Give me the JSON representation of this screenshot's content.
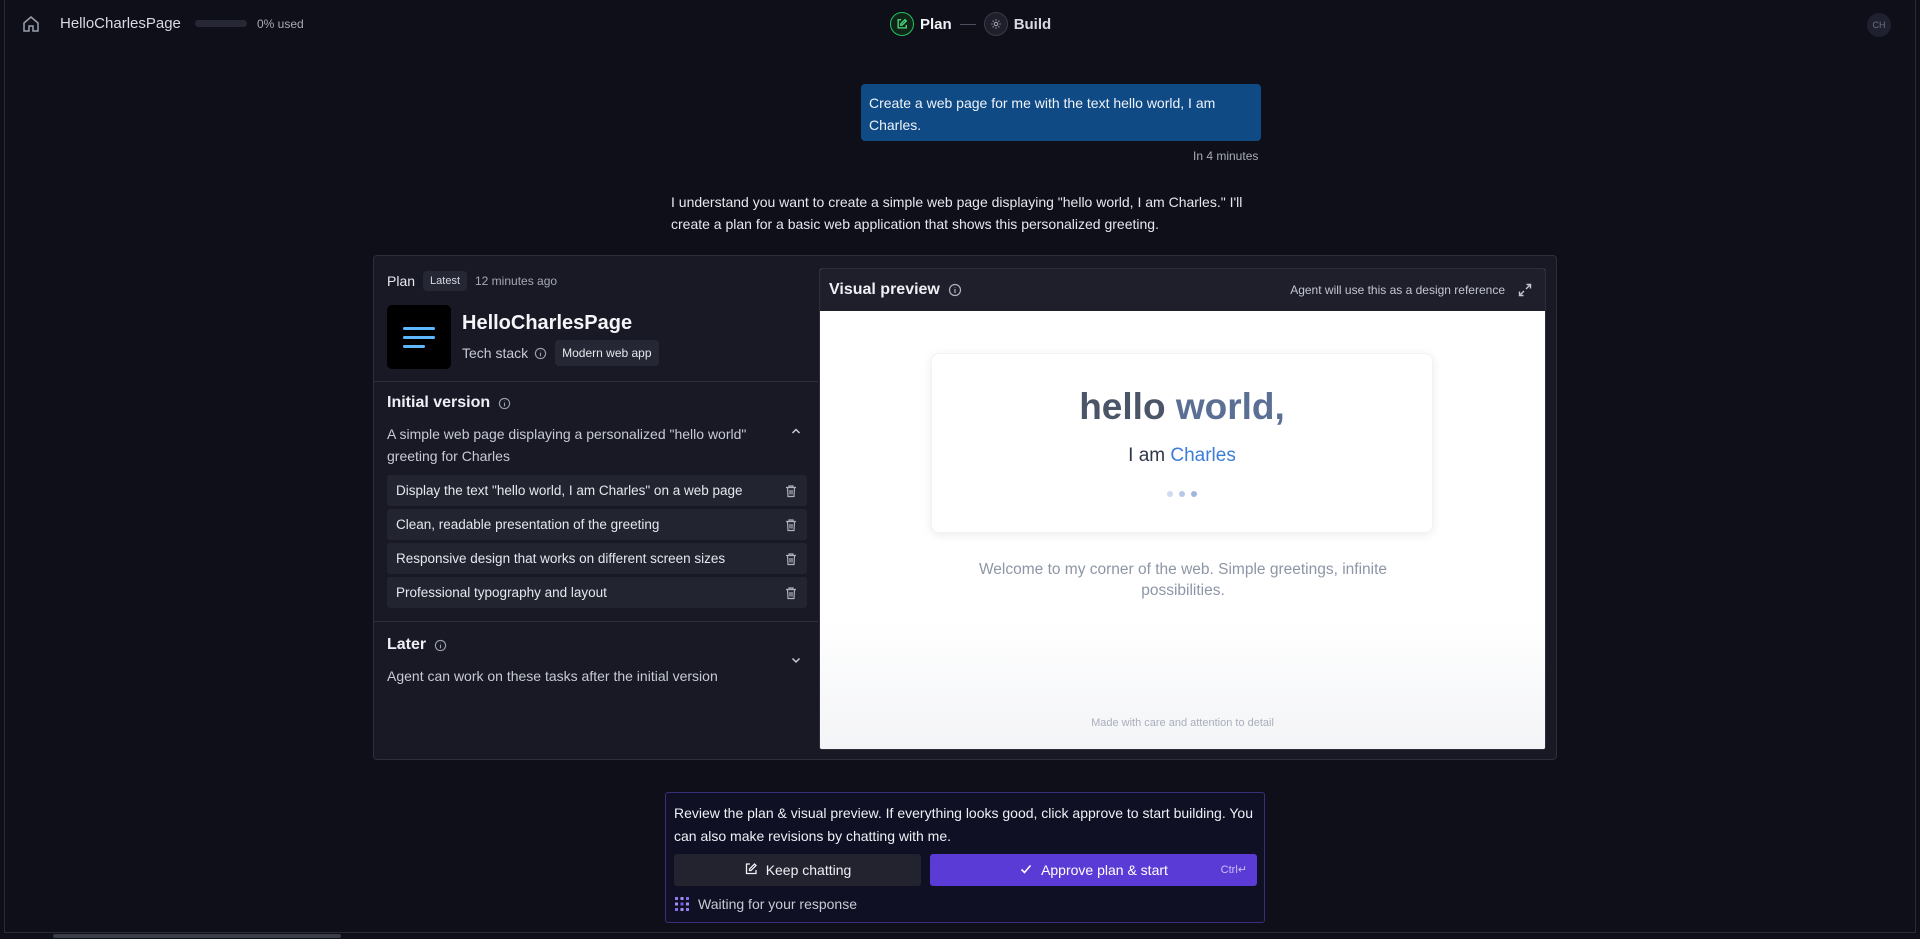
{
  "header": {
    "project_name": "HelloCharlesPage",
    "usage_text": "0% used",
    "usage_fraction": 0,
    "steps": [
      {
        "label": "Plan"
      },
      {
        "label": "Build"
      }
    ],
    "avatar_initials": "CH"
  },
  "chat": {
    "user_message": "Create a web page for me with the text hello world, I am Charles.",
    "user_time": "In 4 minutes",
    "assistant_message": "I understand you want to create a simple web page displaying \"hello world, I am Charles.\" I'll create a plan for a basic web application that shows this personalized greeting."
  },
  "plan": {
    "label": "Plan",
    "badge": "Latest",
    "time": "12 minutes ago",
    "app_title": "HelloCharlesPage",
    "tech_label": "Tech stack",
    "tech_chip": "Modern web app",
    "initial": {
      "title": "Initial version",
      "description": "A simple web page displaying a personalized \"hello world\" greeting for Charles",
      "tasks": [
        "Display the text \"hello world, I am Charles\" on a web page",
        "Clean, readable presentation of the greeting",
        "Responsive design that works on different screen sizes",
        "Professional typography and layout"
      ]
    },
    "later": {
      "title": "Later",
      "description": "Agent can work on these tasks after the initial version"
    }
  },
  "preview": {
    "title": "Visual preview",
    "note": "Agent will use this as a design reference",
    "hero_word1": "hello",
    "hero_word2": "world,",
    "sub_prefix": "I am",
    "sub_name": "Charles",
    "welcome": "Welcome to my corner of the web. Simple greetings, infinite possibilities.",
    "footer": "Made with care and attention to detail"
  },
  "approval": {
    "text": "Review the plan & visual preview. If everything looks good, click approve to start building. You can also make revisions by chatting with me.",
    "keep_label": "Keep chatting",
    "approve_label": "Approve plan & start",
    "shortcut": "Ctrl↵",
    "waiting": "Waiting for your response"
  },
  "colors": {
    "background": "#0e0f19",
    "accent": "#5b3bd6",
    "user_bubble": "#0f4a84",
    "plan_step": "#22c55e"
  }
}
